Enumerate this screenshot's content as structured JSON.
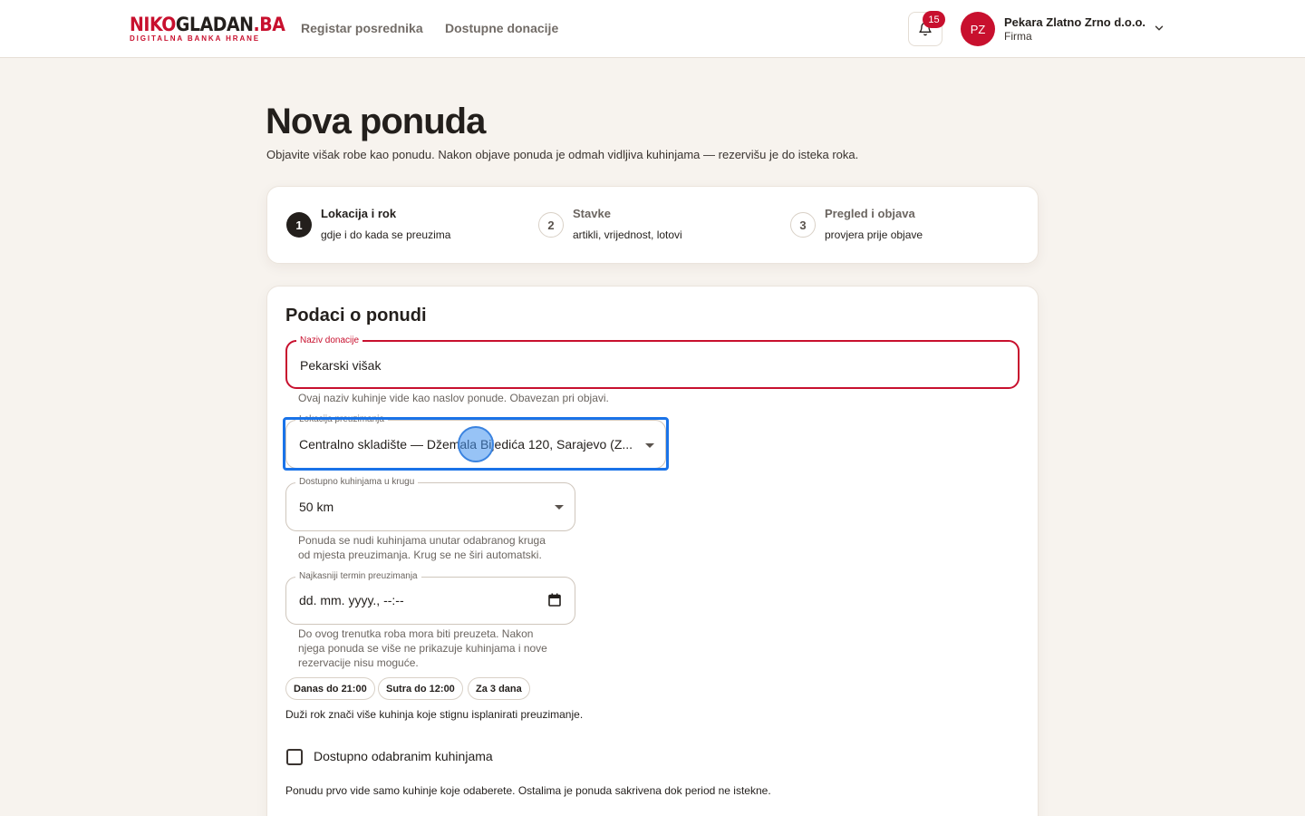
{
  "header": {
    "logo_niko": "NIKO",
    "logo_gladan": "GLADAN",
    "logo_ba": ".BA",
    "logo_tagline": "DIGITALNA BANKA HRANE",
    "nav": [
      "Registar posrednika",
      "Dostupne donacije"
    ],
    "notifications_count": "15",
    "user": {
      "initials": "PZ",
      "name": "Pekara Zlatno Zrno d.o.o.",
      "role": "Firma"
    }
  },
  "page": {
    "title": "Nova ponuda",
    "subtitle": "Objavite višak robe kao ponudu. Nakon objave ponuda je odmah vidljiva kuhinjama — rezervišu je do isteka roka."
  },
  "stepper": [
    {
      "number": "1",
      "title": "Lokacija i rok",
      "desc": "gdje i do kada se preuzima",
      "state": "active"
    },
    {
      "number": "2",
      "title": "Stavke",
      "desc": "artikli, vrijednost, lotovi",
      "state": "idle"
    },
    {
      "number": "3",
      "title": "Pregled i objava",
      "desc": "provjera prije objave",
      "state": "idle"
    }
  ],
  "form": {
    "card_title": "Podaci o ponudi",
    "name": {
      "label": "Naziv donacije",
      "value": "Pekarski višak",
      "helper": "Ovaj naziv kuhinje vide kao naslov ponude. Obavezan pri objavi."
    },
    "location": {
      "label": "Lokacija preuzimanja",
      "value": "Centralno skladište — Džemala Bijedića 120, Sarajevo (Z..."
    },
    "radius": {
      "label": "Dostupno kuhinjama u krugu",
      "value": "50 km",
      "helper_1": "Ponuda se nudi kuhinjama unutar odabranog kruga",
      "helper_2": "od mjesta preuzimanja. Krug se ne širi automatski."
    },
    "deadline": {
      "label": "Najkasniji termin preuzimanja",
      "placeholder": "dd. mm. yyyy., --:--",
      "helper_1": "Do ovog trenutka roba mora biti preuzeta. Nakon",
      "helper_2": "njega ponuda se više ne prikazuje kuhinjama i nove",
      "helper_3": "rezervacije nisu moguće."
    },
    "quick_chips": [
      "Danas do 21:00",
      "Sutra do 12:00",
      "Za 3 dana"
    ],
    "chips_note": "Duži rok znači više kuhinja koje stignu isplanirati preuzimanje.",
    "selected_kitchens": {
      "label": "Dostupno odabranim kuhinjama",
      "checked": false,
      "note": "Ponudu prvo vide samo kuhinje koje odaberete. Ostalima je ponuda sakrivena dok period ne istekne."
    }
  },
  "colors": {
    "brand": "#c8102e",
    "dark": "#231f1c",
    "background": "#f7f3ee",
    "focus": "#1a73e8"
  }
}
